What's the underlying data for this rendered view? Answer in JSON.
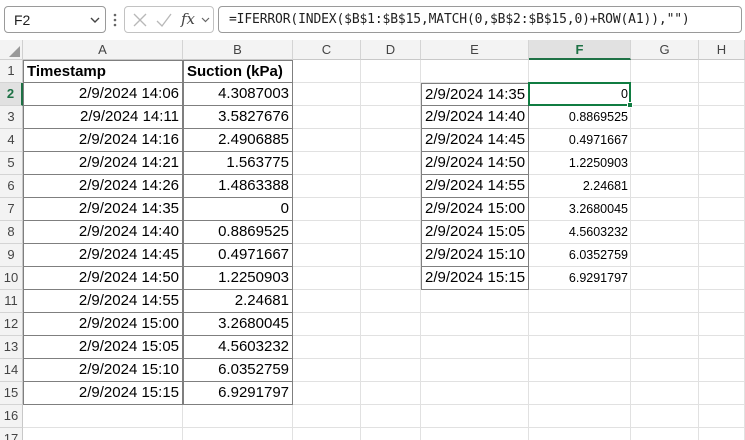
{
  "formula_bar": {
    "name_box": "F2",
    "formula": "=IFERROR(INDEX($B$1:$B$15,MATCH(0,$B$2:$B$15,0)+ROW(A1)),\"\")",
    "fx_label": "fx"
  },
  "columns": [
    "A",
    "B",
    "C",
    "D",
    "E",
    "F",
    "G",
    "H"
  ],
  "rows": [
    "1",
    "2",
    "3",
    "4",
    "5",
    "6",
    "7",
    "8",
    "9",
    "10",
    "11",
    "12",
    "13",
    "14",
    "15",
    "16",
    "17"
  ],
  "selected_cell": {
    "column": "F",
    "row": "2"
  },
  "sheet": {
    "header_a": "Timestamp",
    "header_b": "Suction (kPa)",
    "col_a": [
      "2/9/2024 14:06",
      "2/9/2024 14:11",
      "2/9/2024 14:16",
      "2/9/2024 14:21",
      "2/9/2024 14:26",
      "2/9/2024 14:35",
      "2/9/2024 14:40",
      "2/9/2024 14:45",
      "2/9/2024 14:50",
      "2/9/2024 14:55",
      "2/9/2024 15:00",
      "2/9/2024 15:05",
      "2/9/2024 15:10",
      "2/9/2024 15:15"
    ],
    "col_b": [
      "4.3087003",
      "3.5827676",
      "2.4906885",
      "1.563775",
      "1.4863388",
      "0",
      "0.8869525",
      "0.4971667",
      "1.2250903",
      "2.24681",
      "3.2680045",
      "4.5603232",
      "6.0352759",
      "6.9291797"
    ],
    "col_e": [
      "2/9/2024 14:35",
      "2/9/2024 14:40",
      "2/9/2024 14:45",
      "2/9/2024 14:50",
      "2/9/2024 14:55",
      "2/9/2024 15:00",
      "2/9/2024 15:05",
      "2/9/2024 15:10",
      "2/9/2024 15:15"
    ],
    "col_f": [
      "0",
      "0.8869525",
      "0.4971667",
      "1.2250903",
      "2.24681",
      "3.2680045",
      "4.5603232",
      "6.0352759",
      "6.9291797"
    ]
  },
  "colors": {
    "selection": "#107c41",
    "header_bg": "#f3f3f3",
    "gridline": "#e1e1e1"
  }
}
